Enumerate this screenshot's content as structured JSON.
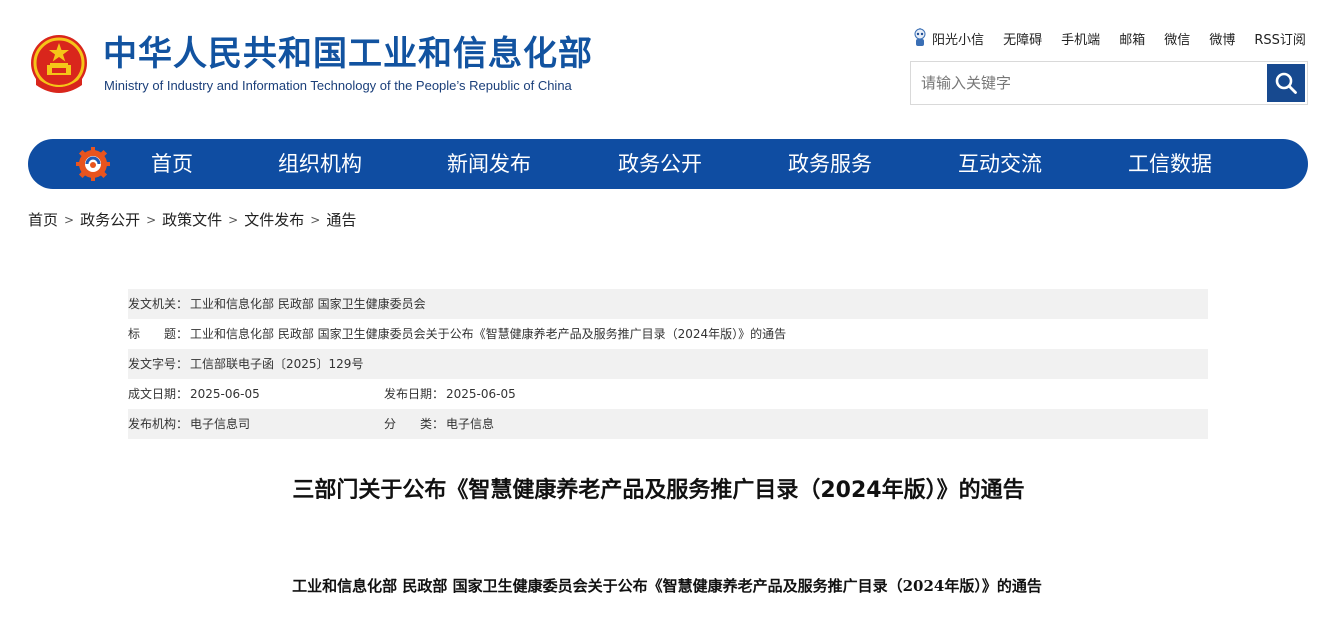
{
  "header": {
    "site_name_cn": "中华人民共和国工业和信息化部",
    "site_name_en": "Ministry of Industry and Information Technology of the People’s Republic of China",
    "emblem_icon": "national-emblem-icon",
    "links": [
      "阳光小信",
      "无障碍",
      "手机端",
      "邮箱",
      "微信",
      "微博",
      "RSS订阅"
    ],
    "search_placeholder": "请输入关键字",
    "search_icon": "search-icon"
  },
  "nav": {
    "logo_icon": "gear-logo-icon",
    "items": [
      "首页",
      "组织机构",
      "新闻发布",
      "政务公开",
      "政务服务",
      "互动交流",
      "工信数据"
    ]
  },
  "breadcrumb": {
    "items": [
      "首页",
      "政务公开",
      "政策文件",
      "文件发布",
      "通告"
    ],
    "separator": ">"
  },
  "meta": {
    "issuer_label": "发文机关：",
    "issuer_value": "工业和信息化部 民政部 国家卫生健康委员会",
    "title_label": "标　　题：",
    "title_value": "工业和信息化部 民政部 国家卫生健康委员会关于公布《智慧健康养老产品及服务推广目录（2024年版）》的通告",
    "docno_label": "发文字号：",
    "docno_value": "工信部联电子函〔2025〕129号",
    "written_label": "成文日期：",
    "written_value": "2025-06-05",
    "published_label": "发布日期：",
    "published_value": "2025-06-05",
    "org_label": "发布机构：",
    "org_value": "电子信息司",
    "category_label": "分　　类：",
    "category_value": "电子信息"
  },
  "article": {
    "title": "三部门关于公布《智慧健康养老产品及服务推广目录（2024年版）》的通告",
    "subtitle": "工业和信息化部  民政部  国家卫生健康委员会关于公布《智慧健康养老产品及服务推广目录（2024年版）》的通告"
  },
  "colors": {
    "brand_blue": "#1253a0",
    "nav_blue": "#0f4da2",
    "search_button": "#17498f",
    "row_shade": "#f1f1f1"
  }
}
